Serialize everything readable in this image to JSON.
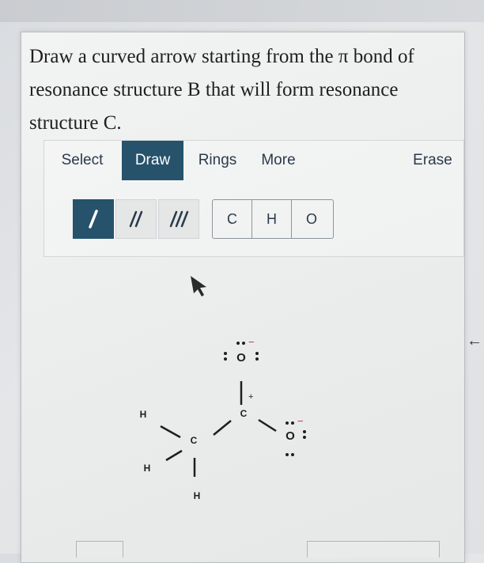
{
  "question": {
    "line1": "Draw a curved arrow starting from the π bond of",
    "line2": "resonance structure B that will form resonance",
    "line3": "structure C."
  },
  "toolbar": {
    "tabs": [
      "Select",
      "Draw",
      "Rings",
      "More",
      "Erase"
    ],
    "active_tab": "Draw"
  },
  "bond_tools": {
    "items": [
      "single-bond",
      "double-bond",
      "triple-bond"
    ],
    "active": "single-bond"
  },
  "atom_tools": [
    "C",
    "H",
    "O"
  ],
  "molecule": {
    "atoms": {
      "o_top": "O",
      "c_carbonyl": "C",
      "c_central": "C",
      "o_right": "O",
      "h_upper": "H",
      "h_lower": "H",
      "h_bottom": "H"
    },
    "charges": {
      "o_top": "−",
      "c_carbonyl": "+",
      "o_right": "−"
    }
  },
  "colors": {
    "accent": "#27526b",
    "text": "#2b3a4a"
  }
}
